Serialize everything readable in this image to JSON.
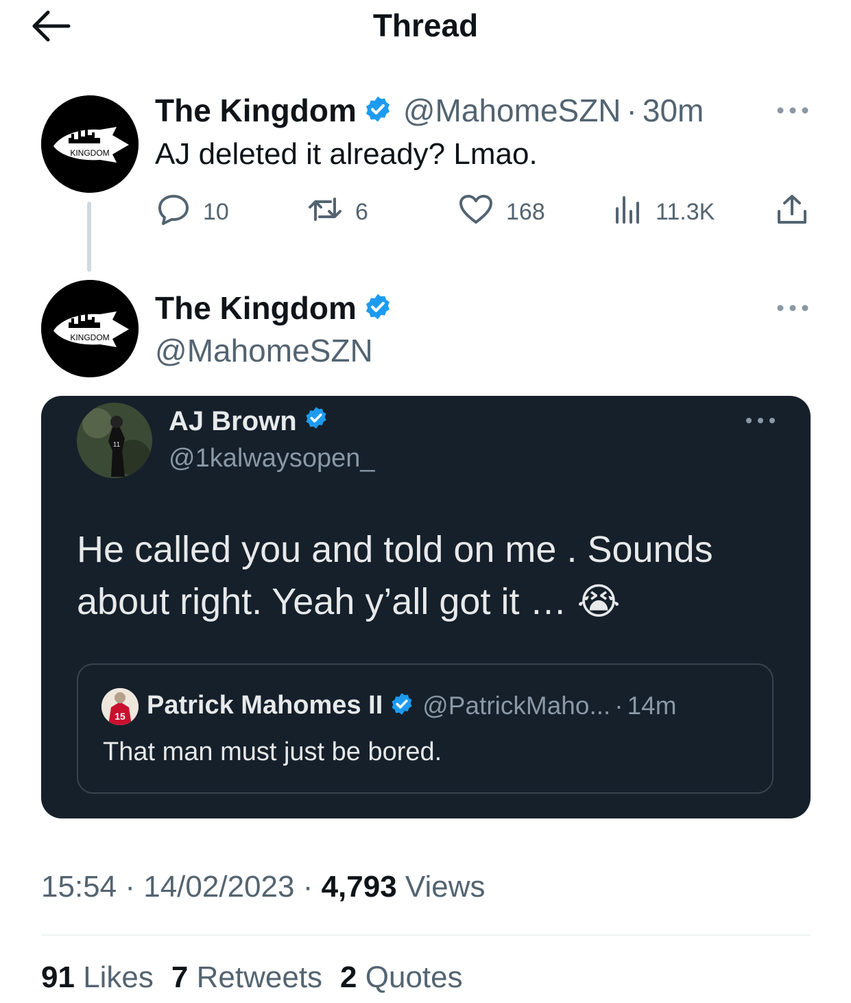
{
  "header": {
    "title": "Thread"
  },
  "colors": {
    "verified_blue": "#1d9bf0",
    "card_bg": "#15202b",
    "secondary_text": "#536471"
  },
  "tweet1": {
    "avatar_label": "KINGDOM",
    "display_name": "The Kingdom",
    "handle": "@MahomeSZN",
    "separator": "·",
    "time": "30m",
    "text": "AJ deleted it already? Lmao.",
    "replies": "10",
    "retweets": "6",
    "likes": "168",
    "views": "11.3K"
  },
  "tweet2": {
    "avatar_label": "KINGDOM",
    "display_name": "The Kingdom",
    "handle": "@MahomeSZN",
    "card": {
      "name": "AJ Brown",
      "handle": "@1kalwaysopen_",
      "text": "He called you and told on me . Sounds about right. Yeah y’all got it … 😭",
      "quote": {
        "name": "Patrick Mahomes II",
        "handle": "@PatrickMaho...",
        "separator": "·",
        "time": "14m",
        "text": "That man must just be bored."
      }
    },
    "meta": {
      "time": "15:54",
      "sep1": "·",
      "date": "14/02/2023",
      "sep2": "·",
      "views_count": "4,793",
      "views_label": "Views"
    },
    "stats": {
      "likes_count": "91",
      "likes_label": "Likes",
      "retweets_count": "7",
      "retweets_label": "Retweets",
      "quotes_count": "2",
      "quotes_label": "Quotes"
    }
  }
}
